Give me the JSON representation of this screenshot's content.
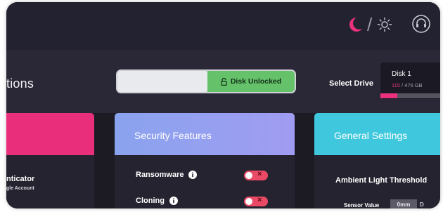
{
  "theme": {
    "slash": "/",
    "moon_icon": "moon-icon",
    "sun_icon": "sun-icon",
    "support_icon": "headset-icon",
    "accent": "#e9317f"
  },
  "page": {
    "title": "tions"
  },
  "lock_toggle": {
    "label": "Disk Unlocked",
    "state": "unlocked",
    "color": "#65c26a"
  },
  "drive": {
    "select_label": "Select Drive",
    "name": "Disk 1",
    "used": "115",
    "separator": " / ",
    "total": "476 GB",
    "used_fraction": 0.24
  },
  "cards": {
    "left": {
      "color": "#e92e7c",
      "item_title": "nticator",
      "item_subtitle": "gle Account"
    },
    "security": {
      "title": "Security Features",
      "color": "#9aa0f0",
      "features": [
        {
          "label": "Ransomware",
          "enabled": false
        },
        {
          "label": "Cloning",
          "enabled": false
        }
      ]
    },
    "general": {
      "title": "General Settings",
      "color": "#3fc8dd",
      "ambient_label": "Ambient Light Threshold",
      "sensor_label": "Sensor Value",
      "sensor_options": [
        "0mm",
        "D"
      ]
    }
  }
}
